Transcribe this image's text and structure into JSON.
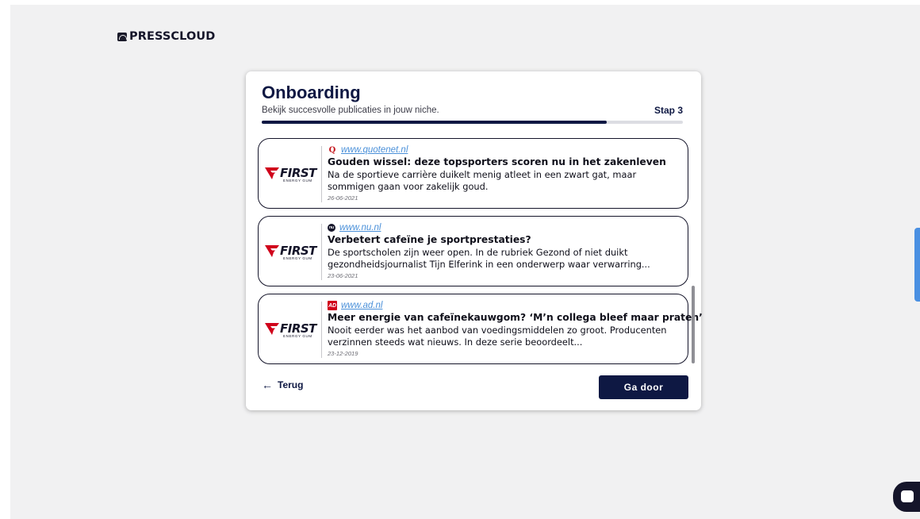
{
  "app": {
    "logo_text": "PRESSCLOUD",
    "logo_icon": "cloud-icon"
  },
  "onboarding": {
    "title": "Onboarding",
    "subtitle": "Bekijk succesvolle publicaties in jouw niche.",
    "step_label": "Stap 3",
    "progress": 0.82
  },
  "articles": [
    {
      "brand_name": "FIRST",
      "brand_sub": "ENERGY GUM",
      "source_icon": "quotenet-favicon",
      "source_glyph": "Q",
      "source_url": "www.quotenet.nl",
      "headline": "Gouden wissel: deze topsporters scoren nu in het zakenleven",
      "excerpt": "Na de sportieve carrière duikelt menig atleet in een zwart gat, maar sommigen gaan voor zakelijk goud.",
      "date": "26-06-2021"
    },
    {
      "brand_name": "FIRST",
      "brand_sub": "ENERGY GUM",
      "source_icon": "nu-favicon",
      "source_glyph": "nu",
      "source_url": "www.nu.nl",
      "headline": "Verbetert cafeïne je sportprestaties?",
      "excerpt": "De sportscholen zijn weer open. In de rubriek Gezond of niet duikt gezondheidsjournalist Tijn Elferink in een onderwerp waar verwarring...",
      "date": "23-06-2021"
    },
    {
      "brand_name": "FIRST",
      "brand_sub": "ENERGY GUM",
      "source_icon": "ad-favicon",
      "source_glyph": "AD",
      "source_url": "www.ad.nl",
      "headline": "Meer energie van cafeïnekauwgom? ‘M’n collega bleef maar praten’",
      "excerpt": "Nooit eerder was het aanbod van voedingsmiddelen zo groot. Producenten verzinnen steeds wat nieuws. In deze serie beoordeelt...",
      "date": "23-12-2019"
    }
  ],
  "actions": {
    "back_label": "Terug",
    "back_icon": "arrow-left-icon",
    "next_label": "Ga door"
  },
  "colors": {
    "primary": "#0e1843",
    "link": "#4a90d9",
    "side_tab": "#4a90e2",
    "background": "#f1f1f2"
  },
  "widgets": {
    "chat_icon": "chat-bubble-icon"
  }
}
